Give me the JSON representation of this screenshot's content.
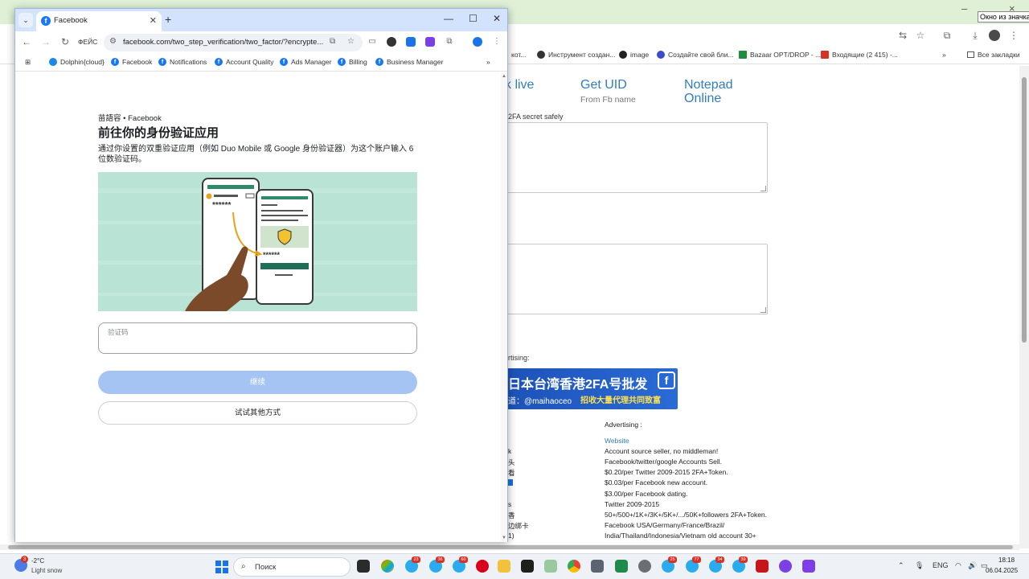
{
  "background_window": {
    "tooltip": "Окно из значка",
    "bookmarks": [
      {
        "label": "кот...",
        "color": "#888888"
      },
      {
        "label": "Инструмент создан...",
        "color": "#333333"
      },
      {
        "label": "image",
        "color": "#222222"
      },
      {
        "label": "Создайте свой бли...",
        "color": "#3b4cca"
      },
      {
        "label": "Bazaar OPT/DROP - ...",
        "color": "#1e8e3e"
      },
      {
        "label": "Входящие (2 415) -...",
        "color": "#d93025"
      }
    ],
    "all_bookmarks_label": "Все закладки",
    "nav": {
      "live": "k live",
      "get_uid": "Get UID",
      "get_uid_sub": "From Fb name",
      "notepad": "Notepad",
      "notepad2": "Online"
    },
    "secret_label": "2FA secret safely",
    "advertising_left": "rtising:",
    "ad_banner": {
      "line1": "日本台湾香港2FA号批发",
      "line2": "道：@maihaoceo",
      "line3": "招收大量代理共同致富"
    },
    "advertising_label": "Advertising :",
    "website_link": "Website",
    "ad_lines": [
      "Account source seller, no middleman!",
      "Facebook/twitter/google Accounts Sell.",
      "$0.20/per Twitter 2009-2015 2FA+Token.",
      "$0.03/per Facebook new account.",
      "$3.00/per Facebook dating.",
      "Twitter 2009-2015",
      "50+/500+/1K+/3K+/5K+/.../50K+followers 2FA+Token.",
      "Facebook USA/Germany/France/Brazil/",
      "India/Thailand/Indonesia/Vietnam old account 30+"
    ],
    "left_fragments": [
      "k",
      "头",
      "看",
      "",
      "s",
      "香",
      "边绑卡",
      "1)"
    ]
  },
  "foreground_window": {
    "tab_title": "Facebook",
    "site_label": "ФЕЙС",
    "url": "facebook.com/two_step_verification/two_factor/?encrypte...",
    "bookmarks": [
      "Dolphin{cloud}",
      "Facebook",
      "Notifications",
      "Account Quality",
      "Ads Manager",
      "Billing",
      "Business Manager"
    ],
    "page": {
      "breadcrumb": "苗語容 • Facebook",
      "title": "前往你的身份验证应用",
      "description": "通过你设置的双重验证应用（例如 Duo Mobile 或 Google 身份验证器）为这个账户输入 6 位数验证码。",
      "illustration": {
        "code_left": "******",
        "code_right": "******"
      },
      "code_placeholder": "验证码",
      "continue_label": "继续",
      "other_label": "试试其他方式"
    }
  },
  "taskbar": {
    "weather_badge": "3",
    "temperature": "-2°C",
    "weather": "Light snow",
    "search_label": "Поиск",
    "badges": [
      "23",
      "36",
      "60",
      "25",
      "77",
      "34",
      "39"
    ],
    "language": "ENG",
    "time": "18:18",
    "date": "06.04.2025"
  }
}
